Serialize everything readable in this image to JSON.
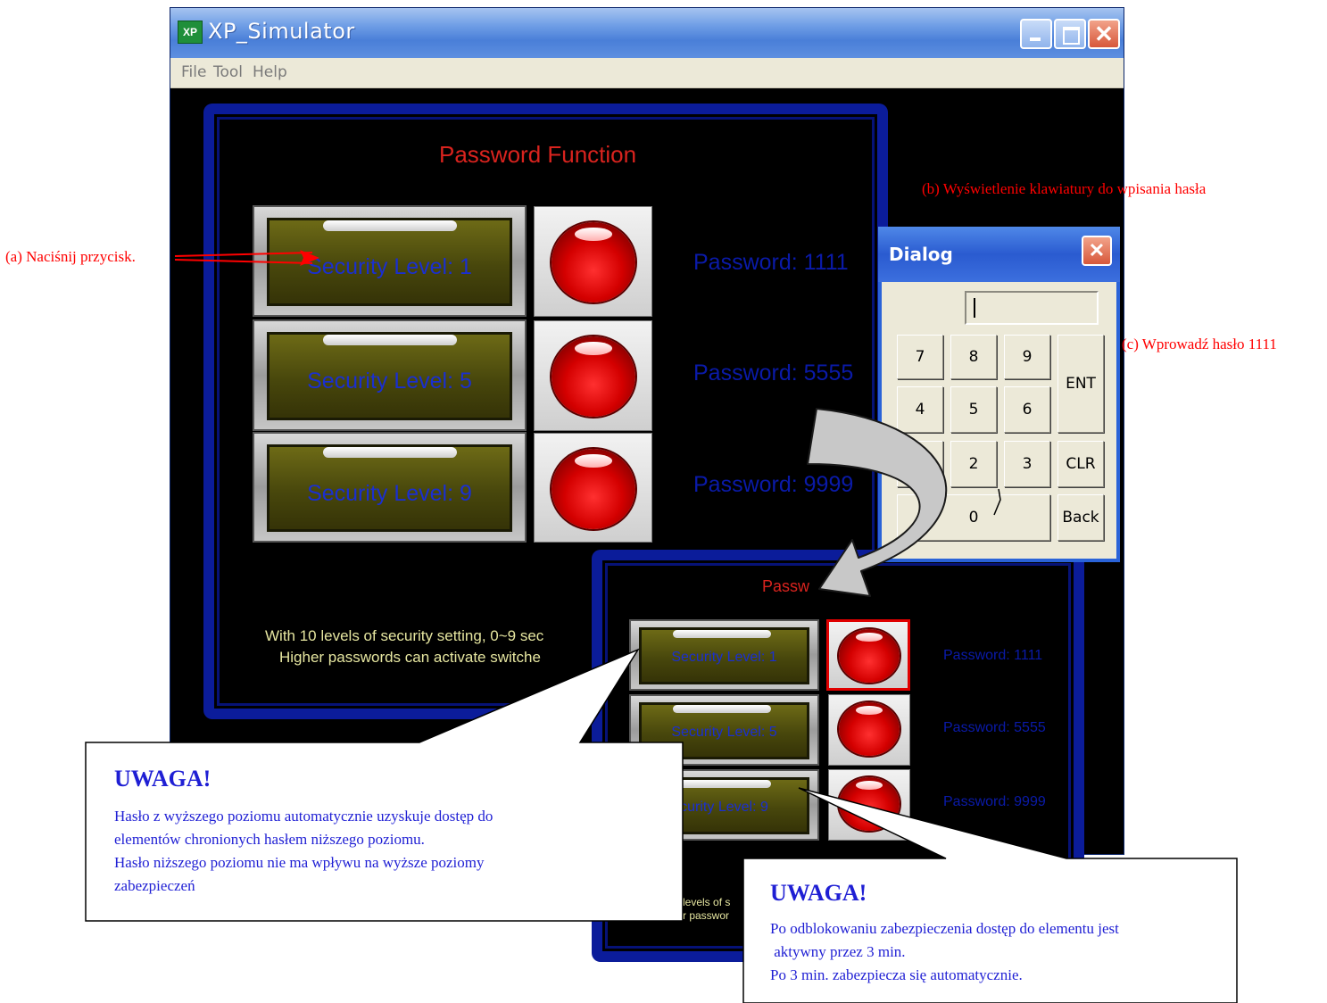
{
  "window": {
    "title": "XP_Simulator",
    "icon": "xp-app-icon",
    "icon_text": "XP",
    "menu": [
      "File",
      "Tool",
      "Help"
    ]
  },
  "main_screen": {
    "title": "Password Function",
    "levels": [
      {
        "label": "Security Level: 1",
        "password": "Password: 1111"
      },
      {
        "label": "Security Level: 5",
        "password": "Password: 5555"
      },
      {
        "label": "Security Level: 9",
        "password": "Password: 9999"
      }
    ],
    "info_line1": "With 10 levels of security setting, 0~9 sec",
    "info_line2": "Higher passwords can activate switche"
  },
  "dialog": {
    "title": "Dialog",
    "close": "✕",
    "input_value": "",
    "keys": {
      "k7": "7",
      "k8": "8",
      "k9": "9",
      "k4": "4",
      "k5": "5",
      "k6": "6",
      "k2": "2",
      "k3": "3",
      "k0": "0",
      "ent": "ENT",
      "clr": "CLR",
      "back": "Back"
    }
  },
  "second_screen": {
    "title": "Passw",
    "levels": [
      {
        "label": "Security Level: 1",
        "password": "Password: 1111"
      },
      {
        "label": "Security Level: 5",
        "password": "Password: 5555"
      },
      {
        "label": "curity Level: 9",
        "password": "Password: 9999"
      }
    ],
    "info_line1": "levels of s",
    "info_line2": "r passwor"
  },
  "annotations": {
    "a": "(a) Naciśnij przycisk.",
    "b": "(b) Wyświetlenie klawiatury do wpisania hasła",
    "c": "(c) Wprowadź hasło 1111"
  },
  "callout1": {
    "heading": "UWAGA!",
    "lines": [
      "Hasło z wyższego poziomu automatycznie uzyskuje dostęp do",
      "elementów chronionych hasłem niższego poziomu.",
      "Hasło niższego poziomu nie ma wpływu na wyższe poziomy",
      "zabezpieczeń"
    ]
  },
  "callout2": {
    "heading": "UWAGA!",
    "lines": [
      "Po odblokowaniu zabezpieczenia dostęp do elementu jest",
      " aktywny przez 3 min.",
      "Po 3 min. zabezpiecza się automatycznie."
    ]
  },
  "colors": {
    "annotation": "#ff0000",
    "callout_text": "#1f1fd4",
    "hmi_border": "#0b1c9a",
    "led": "#d40000"
  }
}
